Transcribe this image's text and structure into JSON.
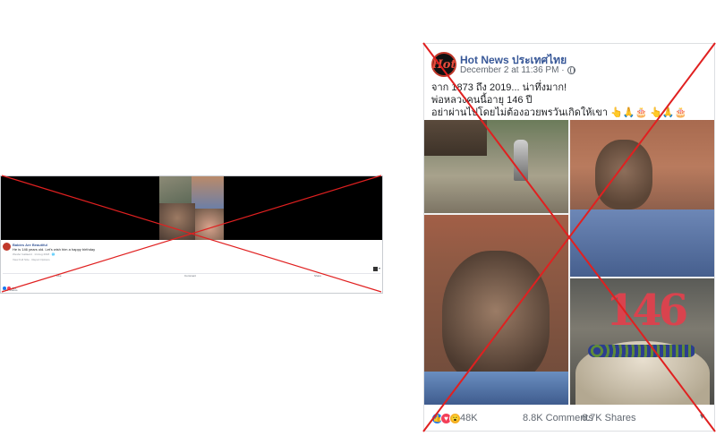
{
  "left_post": {
    "page_name": "Babies Are Beautiful",
    "caption": "He is 146 years old. Let's wish him a happy birthday",
    "meta": "Wesfer Gallaard · 14 Aug 2018 · 🌐",
    "sub_links": "View Full Size · Report Options",
    "actions": {
      "like": "Like",
      "comment": "Comment",
      "share": "Share"
    },
    "reactions": "794",
    "sub_text": "1.4K Shares"
  },
  "right_post": {
    "page_name": "Hot News ประเทศไทย",
    "avatar_text": "Hot",
    "timestamp": "December 2 at 11:36 PM ·",
    "text_lines": [
      "จาก 1873 ถึง 2019... น่าทึ่งมาก!",
      "พ่อหลวงคนนี้อายุ 146 ปี",
      "อย่าผ่านไปโดยไม่ต้องอวยพรวันเกิดให้เขา 👆🙏🎂 👆🙏🎂"
    ],
    "cake_number": "146",
    "reactions_total": "48K",
    "comments": "8.8K Comments",
    "shares": "6.7K Shares"
  },
  "colors": {
    "facebook_blue": "#385898",
    "overlay_red": "#e02020",
    "like": "#1877f2",
    "love": "#f33e58",
    "wow": "#f7b125"
  },
  "icons": [
    "globe-icon",
    "like-icon",
    "love-icon",
    "wow-icon",
    "chevron-down-icon"
  ]
}
